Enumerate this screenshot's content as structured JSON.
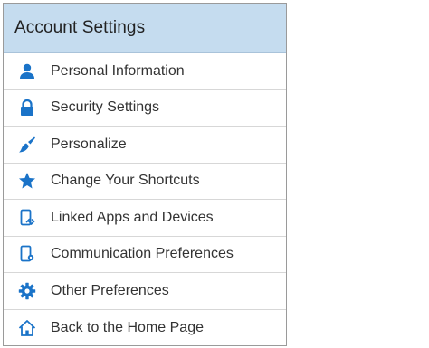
{
  "menu": {
    "title": "Account Settings",
    "accent_color": "#1a73c8",
    "items": [
      {
        "label": "Personal Information",
        "icon": "person-icon"
      },
      {
        "label": "Security Settings",
        "icon": "lock-icon"
      },
      {
        "label": "Personalize",
        "icon": "paintbrush-icon"
      },
      {
        "label": "Change Your Shortcuts",
        "icon": "star-icon"
      },
      {
        "label": "Linked Apps and Devices",
        "icon": "linked-device-icon"
      },
      {
        "label": "Communication Preferences",
        "icon": "device-settings-icon"
      },
      {
        "label": "Other Preferences",
        "icon": "gear-icon"
      },
      {
        "label": "Back to the Home Page",
        "icon": "home-icon"
      }
    ]
  }
}
